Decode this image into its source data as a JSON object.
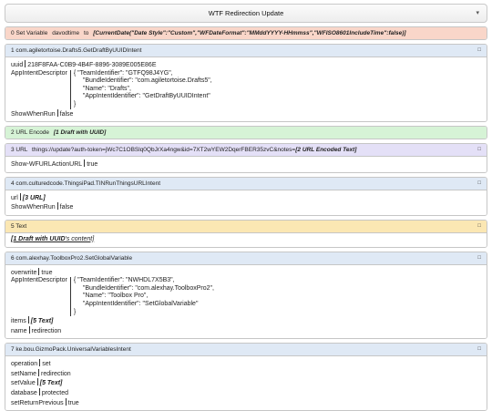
{
  "window": {
    "title": "WTF Redirection Update",
    "menu_icon": "chevron-down-icon"
  },
  "blocks": {
    "b0": {
      "index": "0",
      "name": "Set Variable",
      "var": "davodtime",
      "to": "to",
      "value": "[CurrentDate(\"Date Style\":\"Custom\",\"WFDateFormat\":\"MMddYYYY-HHmmss\",\"WFISO8601IncludeTime\":false)]"
    },
    "b1": {
      "head": "1 com.agiletortoise.Drafts5.GetDraftByUUIDIntent",
      "uuid_key": "uuid",
      "uuid_val": "218F8FAA-C0B9-4B4F-8896-3089E005E86E",
      "desc_key": "AppIntentDescriptor",
      "lines": [
        "{   \"TeamIdentifier\": \"GTFQ98J4YG\",",
        "\"BundleIdentifier\": \"com.agiletortoise.Drafts5\",",
        "\"Name\": \"Drafts\",",
        "\"AppIntentIdentifier\": \"GetDraftByUUIDIntent\"",
        "}"
      ],
      "swr_key": "ShowWhenRun",
      "swr_val": "false"
    },
    "b2": {
      "head": "2 URL Encode",
      "value": "[1 Draft with UUID]"
    },
    "b3": {
      "head": "3 URL",
      "url_text": "things://update?auth-token=jWc7C1OBSlq0QbJrXa4ngw&id=7XT2wYEW2DqerFBER35zvC&notes=",
      "url_var": "[2 URL Encoded Text]",
      "show_key": "Show-WFURLActionURL",
      "show_val": "true"
    },
    "b4": {
      "head": "4 com.culturedcode.ThingsiPad.TINRunThingsURLIntent",
      "url_key": "url",
      "url_val": "[3 URL]",
      "swr_key": "ShowWhenRun",
      "swr_val": "false"
    },
    "b5": {
      "head": "5 Text",
      "value_main": "[1 Draft with UUID",
      "value_rest": "'s content]"
    },
    "b6": {
      "head": "6 com.alexhay.ToolboxPro2.SetGlobalVariable",
      "ow_key": "overwrite",
      "ow_val": "true",
      "desc_key": "AppIntentDescriptor",
      "lines": [
        "{   \"TeamIdentifier\": \"NWHDL7X5B3\",",
        "\"BundleIdentifier\": \"com.alexhay.ToolboxPro2\",",
        "\"Name\": \"Toolbox Pro\",",
        "\"AppIntentIdentifier\": \"SetGlobalVariable\"",
        "}"
      ],
      "items_key": "items",
      "items_val": "[5 Text]",
      "name_key": "name",
      "name_val": "redirection"
    },
    "b7": {
      "head": "7 ke.bou.GizmoPack.UniversalVariablesIntent",
      "rows": [
        {
          "k": "operation",
          "v": "set",
          "strong": false
        },
        {
          "k": "setName",
          "v": "redirection",
          "strong": false
        },
        {
          "k": "setValue",
          "v": "[5 Text]",
          "strong": true
        },
        {
          "k": "database",
          "v": "protected",
          "strong": false
        },
        {
          "k": "setReturnPrevious",
          "v": "true",
          "strong": false
        }
      ]
    }
  },
  "colors": {
    "orange": "#f9d6c9",
    "blue": "#dfe9f5",
    "green": "#d6f3d6",
    "purple": "#e4e0f7",
    "yellow": "#fbe7b3"
  }
}
